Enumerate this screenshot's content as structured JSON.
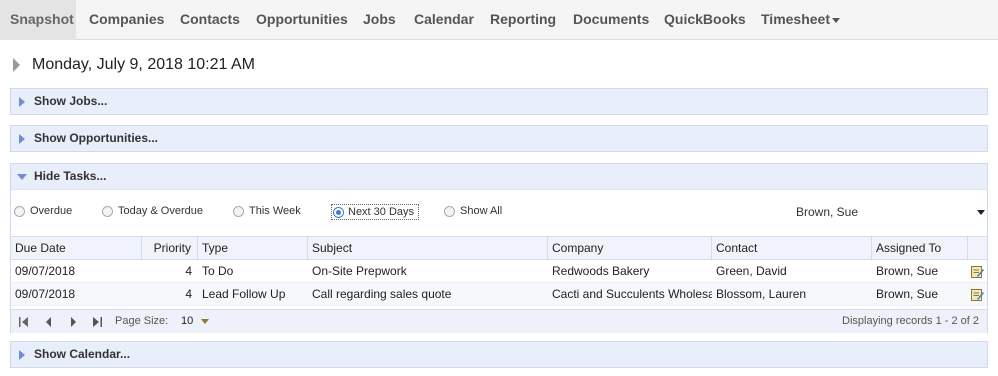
{
  "nav": {
    "items": [
      "Snapshot",
      "Companies",
      "Contacts",
      "Opportunities",
      "Jobs",
      "Calendar",
      "Reporting",
      "Documents",
      "QuickBooks",
      "Timesheet"
    ],
    "active": "Snapshot"
  },
  "date_text": "Monday, July 9, 2018 10:21 AM",
  "sections": {
    "jobs": "Show Jobs...",
    "opportunities": "Show Opportunities...",
    "tasks": "Hide Tasks...",
    "calendar": "Show Calendar..."
  },
  "filters": {
    "options": [
      "Overdue",
      "Today & Overdue",
      "This Week",
      "Next 30 Days",
      "Show All"
    ],
    "selected": "Next 30 Days"
  },
  "assignee": {
    "value": "Brown, Sue"
  },
  "grid": {
    "columns": [
      "Due Date",
      "Priority",
      "Type",
      "Subject",
      "Company",
      "Contact",
      "Assigned To"
    ],
    "rows": [
      {
        "due": "09/07/2018",
        "priority": "4",
        "type": "To Do",
        "subject": "On-Site Prepwork",
        "company": "Redwoods Bakery",
        "contact": "Green, David",
        "assigned": "Brown, Sue"
      },
      {
        "due": "09/07/2018",
        "priority": "4",
        "type": "Lead Follow Up",
        "subject": "Call regarding sales quote",
        "company": "Cacti and Succulents Wholesale",
        "contact": "Blossom, Lauren",
        "assigned": "Brown, Sue"
      }
    ]
  },
  "pager": {
    "page_size_label": "Page Size:",
    "page_size": "10",
    "status": "Displaying records 1 - 2 of 2"
  },
  "icons": {
    "first": "first-page-icon",
    "prev": "prev-page-icon",
    "next": "next-page-icon",
    "last": "last-page-icon",
    "edit": "edit-task-icon"
  }
}
